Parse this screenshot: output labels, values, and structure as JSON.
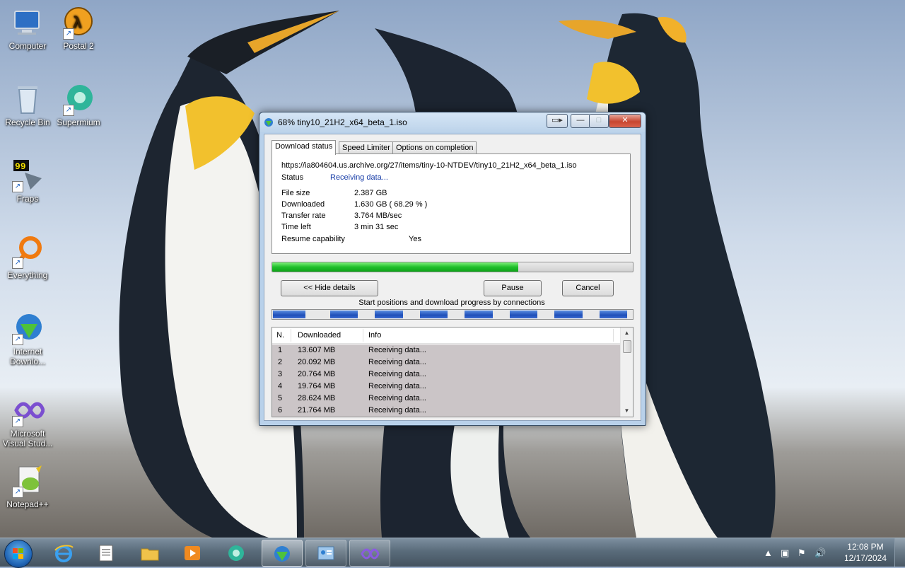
{
  "desktop": {
    "icons": [
      {
        "label": "Computer",
        "icon": "computer-icon"
      },
      {
        "label": "Postal 2",
        "icon": "postal2-icon"
      },
      {
        "label": "Recycle Bin",
        "icon": "recycle-bin-icon"
      },
      {
        "label": "Supermium",
        "icon": "supermium-icon"
      },
      {
        "label": "Fraps",
        "icon": "fraps-icon",
        "badge": "99"
      },
      {
        "label": "Everything",
        "icon": "everything-icon"
      },
      {
        "label": "Internet Downlo...",
        "icon": "internet-download-manager-icon"
      },
      {
        "label": "Microsoft Visual Stud...",
        "icon": "visual-studio-icon"
      },
      {
        "label": "Notepad++",
        "icon": "notepad-plus-plus-icon"
      }
    ]
  },
  "window": {
    "title": "68% tiny10_21H2_x64_beta_1.iso",
    "title_progress": 68,
    "tabs": [
      {
        "label": "Download status",
        "active": true
      },
      {
        "label": "Speed Limiter",
        "active": false
      },
      {
        "label": "Options on completion",
        "active": false
      }
    ],
    "url": "https://ia804604.us.archive.org/27/items/tiny-10-NTDEV/tiny10_21H2_x64_beta_1.iso",
    "status_label": "Status",
    "status_value": "Receiving data...",
    "details": [
      {
        "label": "File size",
        "value": "2.387  GB"
      },
      {
        "label": "Downloaded",
        "value": "1.630  GB  ( 68.29 % )"
      },
      {
        "label": "Transfer rate",
        "value": "3.764  MB/sec"
      },
      {
        "label": "Time left",
        "value": "3 min 31 sec"
      },
      {
        "label": "Resume capability",
        "value": "Yes"
      }
    ],
    "progress_percent": 68.29,
    "buttons": {
      "hide_details": "<< Hide details",
      "pause": "Pause",
      "cancel": "Cancel"
    },
    "connections_label": "Start positions and download progress by connections",
    "connections_progress": [
      0.9,
      0.88,
      0.9,
      0.88,
      0.9,
      0.88,
      0.9,
      0.88
    ],
    "table": {
      "columns": [
        "N.",
        "Downloaded",
        "Info"
      ],
      "rows": [
        {
          "n": "1",
          "downloaded": "13.607  MB",
          "info": "Receiving data..."
        },
        {
          "n": "2",
          "downloaded": "20.092  MB",
          "info": "Receiving data..."
        },
        {
          "n": "3",
          "downloaded": "20.764  MB",
          "info": "Receiving data..."
        },
        {
          "n": "4",
          "downloaded": "19.764  MB",
          "info": "Receiving data..."
        },
        {
          "n": "5",
          "downloaded": "28.624  MB",
          "info": "Receiving data..."
        },
        {
          "n": "6",
          "downloaded": "21.764  MB",
          "info": "Receiving data..."
        }
      ]
    }
  },
  "taskbar": {
    "apps": [
      {
        "icon": "internet-explorer-icon",
        "state": "pinned"
      },
      {
        "icon": "notepad-icon",
        "state": "pinned"
      },
      {
        "icon": "file-explorer-icon",
        "state": "pinned"
      },
      {
        "icon": "media-player-icon",
        "state": "pinned"
      },
      {
        "icon": "supermium-icon",
        "state": "pinned"
      },
      {
        "icon": "internet-download-manager-icon",
        "state": "active"
      },
      {
        "icon": "control-panel-icon",
        "state": "open"
      },
      {
        "icon": "visual-studio-icon",
        "state": "open"
      }
    ],
    "time": "12:08 PM",
    "date": "12/17/2024"
  },
  "colors": {
    "accent_blue": "#1a3fa8",
    "progress_green": "#1fbf2b",
    "connection_blue": "#1f4fb8"
  }
}
